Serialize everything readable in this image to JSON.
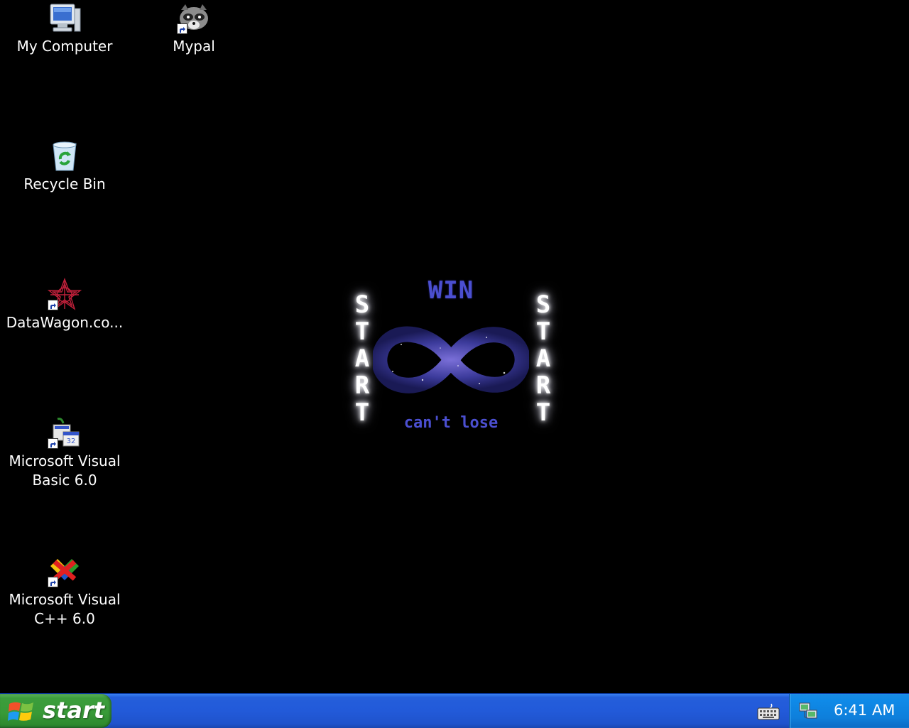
{
  "desktop": {
    "icons": [
      {
        "label": "My Computer",
        "icon": "my-computer-icon"
      },
      {
        "label": "Mypal",
        "icon": "mypal-raccoon-icon"
      },
      {
        "label": "Recycle Bin",
        "icon": "recycle-bin-icon"
      },
      {
        "label": "DataWagon.co...",
        "icon": "datawagon-icon"
      },
      {
        "label": "Microsoft Visual\nBasic 6.0",
        "icon": "visual-basic-icon"
      },
      {
        "label": "Microsoft Visual\nC++ 6.0",
        "icon": "visual-cpp-icon"
      }
    ],
    "wallpaper": {
      "top_text": "WIN",
      "bottom_text": "can't lose",
      "side_text": "START"
    }
  },
  "taskbar": {
    "start_label": "start",
    "clock": "6:41 AM",
    "tray_icons": [
      "keyboard-icon",
      "network-icon"
    ]
  },
  "colors": {
    "desktop_bg": "#000000",
    "taskbar_blue": "#245edb",
    "start_green": "#3c9e3c",
    "tray_blue": "#0f8ae8",
    "wallpaper_text": "#4b4fd0"
  }
}
